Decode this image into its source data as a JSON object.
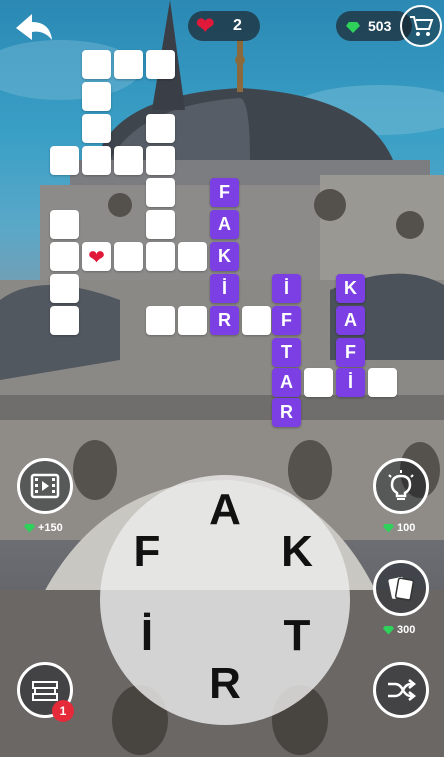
{
  "top_bar": {
    "lives": "2",
    "gems": "503"
  },
  "grid": {
    "words": [
      "FAKİR",
      "İFTAR",
      "KAFİ"
    ],
    "row_1_letters": [
      "F"
    ],
    "row_2_letters": [
      "A"
    ],
    "row_3_letters": [
      "K"
    ],
    "row_4_letters": [
      "İ",
      "İ",
      "K"
    ],
    "row_5_letters": [
      "R",
      "F",
      "A"
    ],
    "row_6_letters": [
      "T",
      "F"
    ],
    "row_7_letters": [
      "A",
      "İ"
    ],
    "row_8_letters": [
      "R"
    ]
  },
  "boosters": {
    "video_reward": "+150",
    "hint_cost": "100",
    "reveal_cost": "300",
    "notification_count": "1"
  },
  "wheel": {
    "letters": [
      "A",
      "K",
      "T",
      "R",
      "İ",
      "F"
    ]
  },
  "colors": {
    "tile_filled": "#7b3fe4",
    "tile_empty": "#ffffff",
    "heart": "#e0193b",
    "gem": "#2ed15a"
  }
}
